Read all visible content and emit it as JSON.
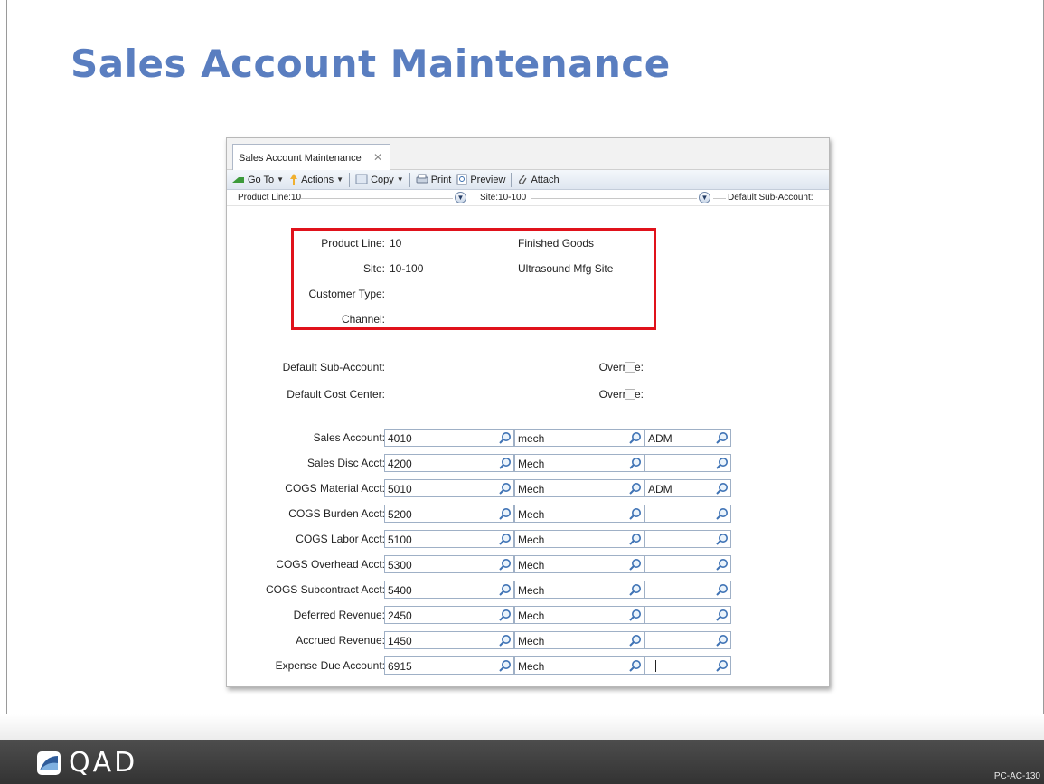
{
  "slide": {
    "title": "Sales Account Maintenance",
    "logo_text": "QAD",
    "slide_code": "PC-AC-130"
  },
  "window": {
    "tab_label": "Sales Account Maintenance",
    "tab_close_icon": "close-icon",
    "toolbar": {
      "goto_label": "Go To",
      "actions_label": "Actions",
      "copy_label": "Copy",
      "print_label": "Print",
      "preview_label": "Preview",
      "attach_label": "Attach"
    },
    "nav": {
      "product_line": "Product Line:10",
      "site": "Site:10-100",
      "default_sub_account": "Default Sub-Account:"
    }
  },
  "header_fields": [
    {
      "label": "Product Line:",
      "value": "10",
      "description": "Finished Goods"
    },
    {
      "label": "Site:",
      "value": "10-100",
      "description": "Ultrasound Mfg Site"
    },
    {
      "label": "Customer Type:",
      "value": "",
      "description": ""
    },
    {
      "label": "Channel:",
      "value": "",
      "description": ""
    }
  ],
  "defaults": [
    {
      "label": "Default Sub-Account:",
      "override_label": "Override:",
      "override_checked": false
    },
    {
      "label": "Default Cost Center:",
      "override_label": "Override:",
      "override_checked": false
    }
  ],
  "accounts": [
    {
      "label": "Sales Account:",
      "account": "4010",
      "sub": "mech",
      "cc": "ADM"
    },
    {
      "label": "Sales Disc Acct:",
      "account": "4200",
      "sub": "Mech",
      "cc": ""
    },
    {
      "label": "COGS Material Acct:",
      "account": "5010",
      "sub": "Mech",
      "cc": "ADM"
    },
    {
      "label": "COGS Burden Acct:",
      "account": "5200",
      "sub": "Mech",
      "cc": ""
    },
    {
      "label": "COGS Labor Acct:",
      "account": "5100",
      "sub": "Mech",
      "cc": ""
    },
    {
      "label": "COGS Overhead Acct:",
      "account": "5300",
      "sub": "Mech",
      "cc": ""
    },
    {
      "label": "COGS Subcontract Acct:",
      "account": "5400",
      "sub": "Mech",
      "cc": ""
    },
    {
      "label": "Deferred Revenue:",
      "account": "2450",
      "sub": "Mech",
      "cc": ""
    },
    {
      "label": "Accrued Revenue:",
      "account": "1450",
      "sub": "Mech",
      "cc": ""
    },
    {
      "label": "Expense Due Account:",
      "account": "6915",
      "sub": "Mech",
      "cc": ""
    }
  ],
  "colors": {
    "title": "#5a7ec0",
    "highlight_box": "#e0121b",
    "footer": "#3d3d3d"
  }
}
